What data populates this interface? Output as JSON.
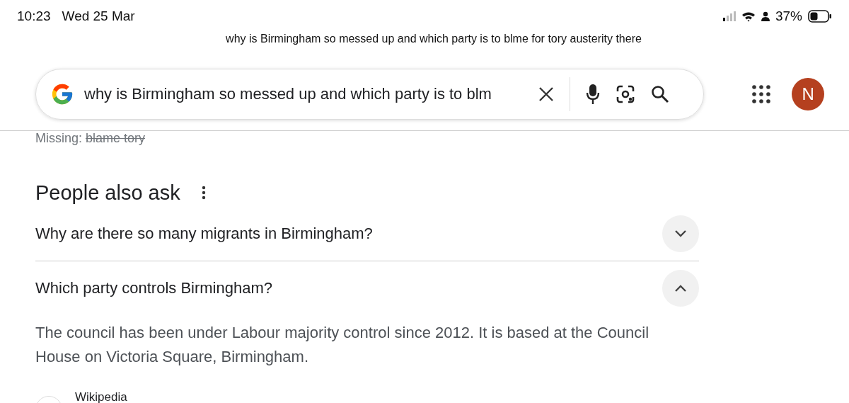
{
  "status_bar": {
    "time": "10:23",
    "date": "Wed 25 Mar",
    "battery": "37%"
  },
  "caption": "why is Birmingham so messed up and which party is to blme for tory austerity there",
  "search": {
    "value": "why is Birmingham so messed up and which party is to blm",
    "avatar": "N"
  },
  "missing": {
    "label": "Missing:",
    "terms": "blame tory"
  },
  "people_also_ask": {
    "title": "People also ask",
    "questions": [
      {
        "text": "Why are there so many migrants in Birmingham?",
        "expanded": false
      },
      {
        "text": "Which party controls Birmingham?",
        "expanded": true,
        "answer": "The council has been under Labour majority control since 2012. It is based at the Council House on Victoria Square, Birmingham.",
        "source": "Wikipedia"
      }
    ]
  }
}
